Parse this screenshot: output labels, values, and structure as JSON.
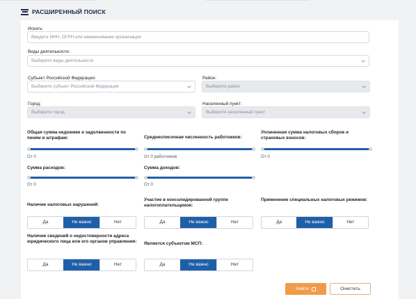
{
  "header": {
    "title": "РАСШИРЕННЫЙ ПОИСК",
    "icon": "filter-lines-icon"
  },
  "search": {
    "label": "Искать:",
    "placeholder": "Введите ИНН, ОГРН или наименование организации"
  },
  "activity": {
    "label": "Виды деятельности:",
    "placeholder": "Выберите виды деятельности"
  },
  "subject": {
    "label": "Субъект Российской Федерации:",
    "placeholder": "Выберите субъект Российской Федерации"
  },
  "district": {
    "label": "Район:",
    "placeholder": "Выберите район"
  },
  "city": {
    "label": "Город:",
    "placeholder": "Выберите город"
  },
  "locality": {
    "label": "Населенный пункт:",
    "placeholder": "Выберите населенный пункт"
  },
  "sliders": {
    "arrears": {
      "label": "Общая сумма недоимки и задолженности по пеням и штрафам:",
      "value": "От 0"
    },
    "employees": {
      "label": "Среднесписочная численность работников:",
      "value": "От 0 работников"
    },
    "taxes_paid": {
      "label": "Уплаченная сумма налоговых сборов и страховых взносов:",
      "value": "От 0"
    },
    "expenses": {
      "label": "Сумма расходов:",
      "value": "От 0"
    },
    "income": {
      "label": "Сумма доходов:",
      "value": "От 0"
    }
  },
  "toggles": {
    "options": [
      "Да",
      "Не важно",
      "Нет"
    ],
    "violations": {
      "label": "Наличие налоговых нарушений:",
      "selected": "Не важно"
    },
    "consolidated": {
      "label": "Участие в консолидированной группе налогоплательщиков:",
      "selected": "Не важно"
    },
    "special_tax": {
      "label": "Применение специальных налоговых режимов:",
      "selected": "Не важно"
    },
    "unreliable": {
      "label": "Наличие сведений о недостоверности адреса юридического лица или его органов управления:",
      "selected": "Не важно"
    },
    "msp": {
      "label": "Является субъектом МСП:",
      "selected": "Не важно"
    }
  },
  "actions": {
    "find": "Найти",
    "clear": "Очистить"
  },
  "colors": {
    "accent": "#1f5fa8",
    "find_button": "#f19b4a",
    "title": "#1c2a4a"
  }
}
